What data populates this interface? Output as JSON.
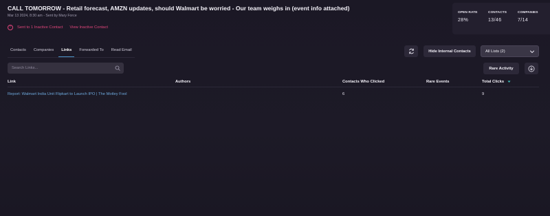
{
  "header": {
    "title": "CALL TOMORROW - Retail forecast, AMZN updates, should Walmart be worried - Our team weighs in (event info attached)",
    "meta": "Mar 13 2024, 8:30 am - Sent by Mary Force",
    "warning_icon": "exclamation-circle-icon",
    "warning_text": "Sent to 1 Inactive Contact",
    "view_inactive_label": "View Inactive Contact",
    "accent_color": "#e0457b"
  },
  "stats": [
    {
      "label": "OPEN RATE",
      "value": "28%"
    },
    {
      "label": "CONTACTS",
      "value": "13/46"
    },
    {
      "label": "COMPANIES",
      "value": "7/14"
    }
  ],
  "tabs": [
    {
      "label": "Contacts",
      "active": false
    },
    {
      "label": "Companies",
      "active": false
    },
    {
      "label": "Links",
      "active": true
    },
    {
      "label": "Forwarded To",
      "active": false
    },
    {
      "label": "Read Email",
      "active": false
    }
  ],
  "toolbar": {
    "refresh_icon": "refresh-icon",
    "hide_internal_label": "Hide Internal Contacts",
    "lists_select_value": "All Lists (2)",
    "search_placeholder": "Search Links...",
    "rare_activity_label": "Rare Activity",
    "download_icon": "download-icon"
  },
  "table": {
    "columns": [
      "Link",
      "Authors",
      "Contacts Who Clicked",
      "Rare Events",
      "Total Clicks"
    ],
    "sorted_column": "Total Clicks",
    "rows": [
      {
        "link": "Report: Walmart India Unit Flipkart to Launch IPO | The Motley Fool",
        "authors": "",
        "contacts_who_clicked": "6",
        "rare_events": "",
        "total_clicks": "9"
      }
    ]
  },
  "colors": {
    "background": "#1b1825",
    "link": "#6da9dc",
    "active_tab_underline": "#4d95c9",
    "sort_indicator": "#3fc7c0"
  }
}
